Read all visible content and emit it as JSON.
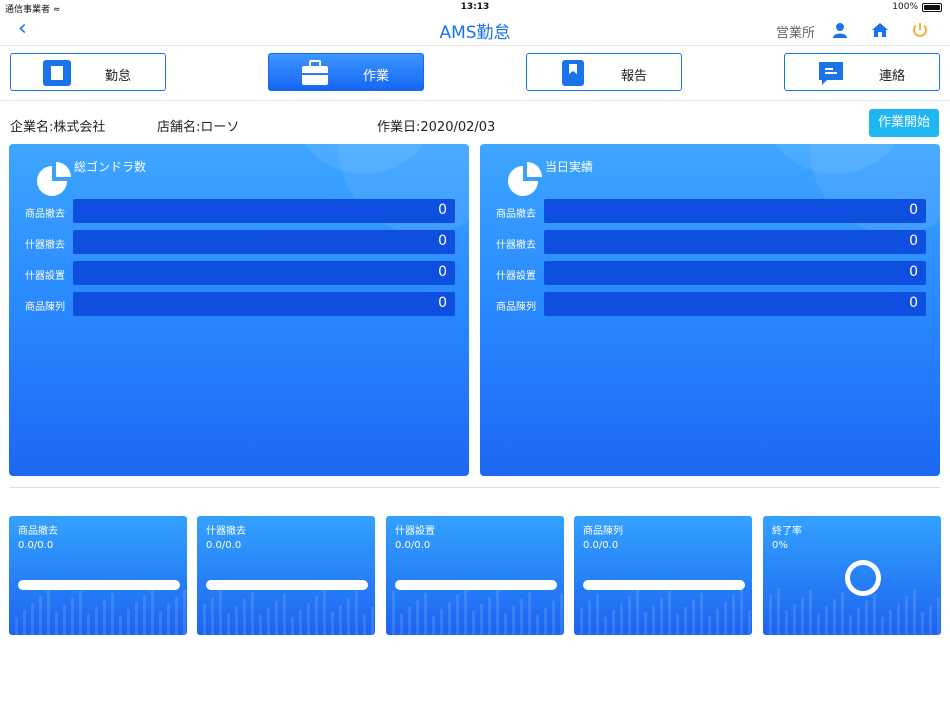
{
  "status_bar": {
    "carrier": "通信事業者",
    "time": "13:13",
    "battery": "100%"
  },
  "nav": {
    "title": "AMS勤怠",
    "office": "営業所",
    "back_icon": "chevron-left-icon"
  },
  "tabs": [
    {
      "label": "勤怠",
      "icon": "square-icon",
      "active": false
    },
    {
      "label": "作業",
      "icon": "briefcase-icon",
      "active": true
    },
    {
      "label": "報告",
      "icon": "bookmark-icon",
      "active": false
    },
    {
      "label": "連絡",
      "icon": "message-icon",
      "active": false
    }
  ],
  "info": {
    "company": "企業名:株式会社",
    "store": "店舗名:ローソ",
    "work_date": "作業日:2020/02/03",
    "start_button": "作業開始"
  },
  "panels": [
    {
      "title": "総ゴンドラ数",
      "rows": [
        {
          "label": "商品撤去",
          "value": "0"
        },
        {
          "label": "什器撤去",
          "value": "0"
        },
        {
          "label": "什器設置",
          "value": "0"
        },
        {
          "label": "商品陳列",
          "value": "0"
        }
      ]
    },
    {
      "title": "当日実績",
      "rows": [
        {
          "label": "商品撤去",
          "value": "0"
        },
        {
          "label": "什器撤去",
          "value": "0"
        },
        {
          "label": "什器設置",
          "value": "0"
        },
        {
          "label": "商品陳列",
          "value": "0"
        }
      ]
    }
  ],
  "cards": [
    {
      "label": "商品撤去",
      "value": "0.0/0.0",
      "progress": 0
    },
    {
      "label": "什器撤去",
      "value": "0.0/0.0",
      "progress": 0
    },
    {
      "label": "什器設置",
      "value": "0.0/0.0",
      "progress": 0
    },
    {
      "label": "商品陳列",
      "value": "0.0/0.0",
      "progress": 0
    },
    {
      "label": "終了率",
      "value": "0%",
      "progress": 0
    }
  ],
  "colors": {
    "accent": "#1a73e8",
    "panel_top": "#3ea6ff",
    "panel_bottom": "#1d67f3",
    "start_button": "#1fb7f3",
    "power_icon": "#f5a623"
  }
}
